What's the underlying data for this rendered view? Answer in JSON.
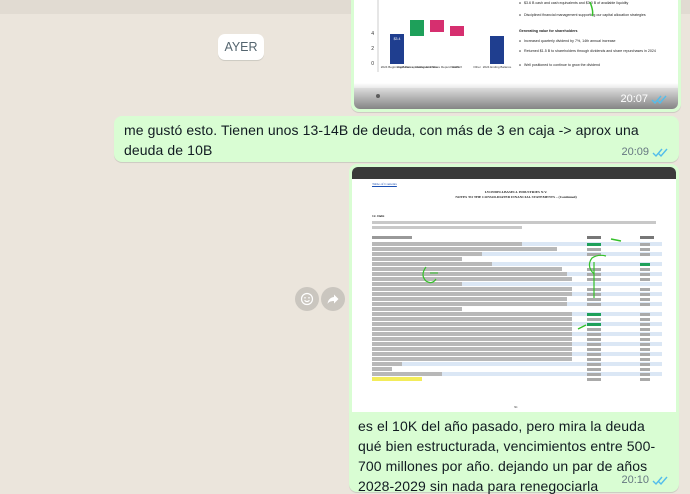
{
  "date_separator": "AYER",
  "messages": [
    {
      "type": "image",
      "time": "20:07",
      "status": "read",
      "slide_bullets": [
        "$3.6 B cash and cash equivalents and $3.0 B of available liquidity",
        "Disciplined financial management supporting our capital allocation strategies",
        "Generating value for shareholders",
        "Increased quarterly dividend by 7%, 14th annual increase",
        "Returned $1.5 B to shareholders through dividends and share repurchases in 2024",
        "Well positioned to continue to grow the dividend"
      ],
      "slide_bars": [
        "2024 Beginning Balance",
        "Cash from operating activities",
        "Dividends & Share Repurchases",
        "CAPEX",
        "Other",
        "2024 Ending Balance"
      ]
    },
    {
      "type": "text",
      "text": "me gustó esto. Tienen unos 13-14B de deuda, con más de 3 en caja -> aprox una deuda de 10B",
      "time": "20:09",
      "status": "read"
    },
    {
      "type": "image_with_caption",
      "doc_company": "LYONDELLBASELL INDUSTRIES N.V.",
      "doc_title": "NOTES TO THE CONSOLIDATED FINANCIAL STATEMENTS – (Continued)",
      "doc_section": "12. Debt",
      "doc_page": "91",
      "caption": "es el 10K del año pasado, pero mira la deuda qué bien estructurada, vencimientos entre 500-700 millones por año. dejando un par de años 2028-2029 sin nada para renegociarla",
      "time": "20:10",
      "status": "read"
    }
  ],
  "actions": {
    "react_icon": "smiley-icon",
    "forward_icon": "forward-icon"
  },
  "colors": {
    "outgoing_bubble": "#d9fdd3",
    "read_ticks": "#53bdeb",
    "wallpaper": "#ebe5dc"
  }
}
